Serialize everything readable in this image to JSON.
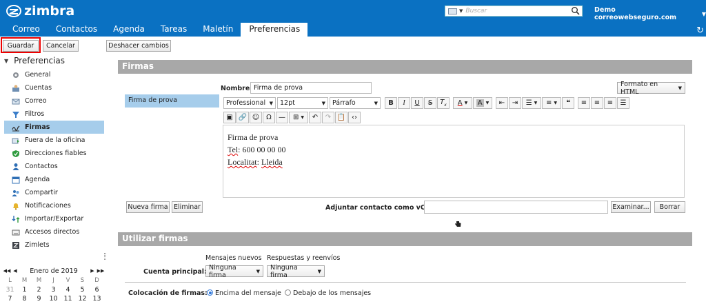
{
  "app": {
    "logo": "zimbra",
    "search_placeholder": "Buscar",
    "user": "Demo correowebseguro.com"
  },
  "tabs": [
    "Correo",
    "Contactos",
    "Agenda",
    "Tareas",
    "Maletín",
    "Preferencias"
  ],
  "toolbar": {
    "save": "Guardar",
    "cancel": "Cancelar",
    "undo": "Deshacer cambios"
  },
  "sidebar": {
    "title": "Preferencias",
    "items": [
      {
        "label": "General",
        "icon": "gear-icon"
      },
      {
        "label": "Cuentas",
        "icon": "accounts-icon"
      },
      {
        "label": "Correo",
        "icon": "mail-icon"
      },
      {
        "label": "Filtros",
        "icon": "filter-icon"
      },
      {
        "label": "Firmas",
        "icon": "signature-icon",
        "selected": true
      },
      {
        "label": "Fuera de la oficina",
        "icon": "out-of-office-icon"
      },
      {
        "label": "Direcciones fiables",
        "icon": "shield-icon"
      },
      {
        "label": "Contactos",
        "icon": "contacts-icon"
      },
      {
        "label": "Agenda",
        "icon": "calendar-icon"
      },
      {
        "label": "Compartir",
        "icon": "share-icon"
      },
      {
        "label": "Notificaciones",
        "icon": "bell-icon"
      },
      {
        "label": "Importar/Exportar",
        "icon": "import-export-icon"
      },
      {
        "label": "Accesos directos",
        "icon": "shortcuts-icon"
      },
      {
        "label": "Zimlets",
        "icon": "zimlet-icon"
      }
    ]
  },
  "calendar": {
    "month": "Enero de 2019",
    "dow": [
      "L",
      "M",
      "M",
      "J",
      "V",
      "S",
      "D"
    ],
    "rows": [
      [
        "31",
        "1",
        "2",
        "3",
        "4",
        "5",
        "6"
      ],
      [
        "7",
        "8",
        "9",
        "10",
        "11",
        "12",
        "13"
      ]
    ]
  },
  "firmas": {
    "section_title": "Firmas",
    "list": [
      "Firma de prova"
    ],
    "name_label": "Nombre:",
    "name_value": "Firma de prova",
    "format": "Formato en HTML",
    "font": "Professional",
    "size": "12pt",
    "block": "Párrafo",
    "body": {
      "line1": "Firma de prova",
      "line2_a": "Tel",
      "line2_b": ": 600 00 00 00",
      "line3_a": "Localitat",
      "line3_b": ": ",
      "line3_c": "Lleida"
    },
    "new_button": "Nueva firma",
    "delete_button": "Eliminar",
    "vcard_label": "Adjuntar contacto como vCard:",
    "browse_button": "Examinar...",
    "clear_button": "Borrar"
  },
  "utilizar": {
    "section_title": "Utilizar firmas",
    "col_new": "Mensajes nuevos",
    "col_reply": "Respuestas y reenvíos",
    "account_label": "Cuenta principal:",
    "new_value": "Ninguna firma",
    "reply_value": "Ninguna firma",
    "placement_label": "Colocación de firmas:",
    "opt_above": "Encima del mensaje",
    "opt_below": "Debajo de los mensajes"
  },
  "colors": {
    "brand": "#0a71c2",
    "selected": "#a6cdeb",
    "section": "#a8a8a8",
    "highlight": "#e00000"
  }
}
